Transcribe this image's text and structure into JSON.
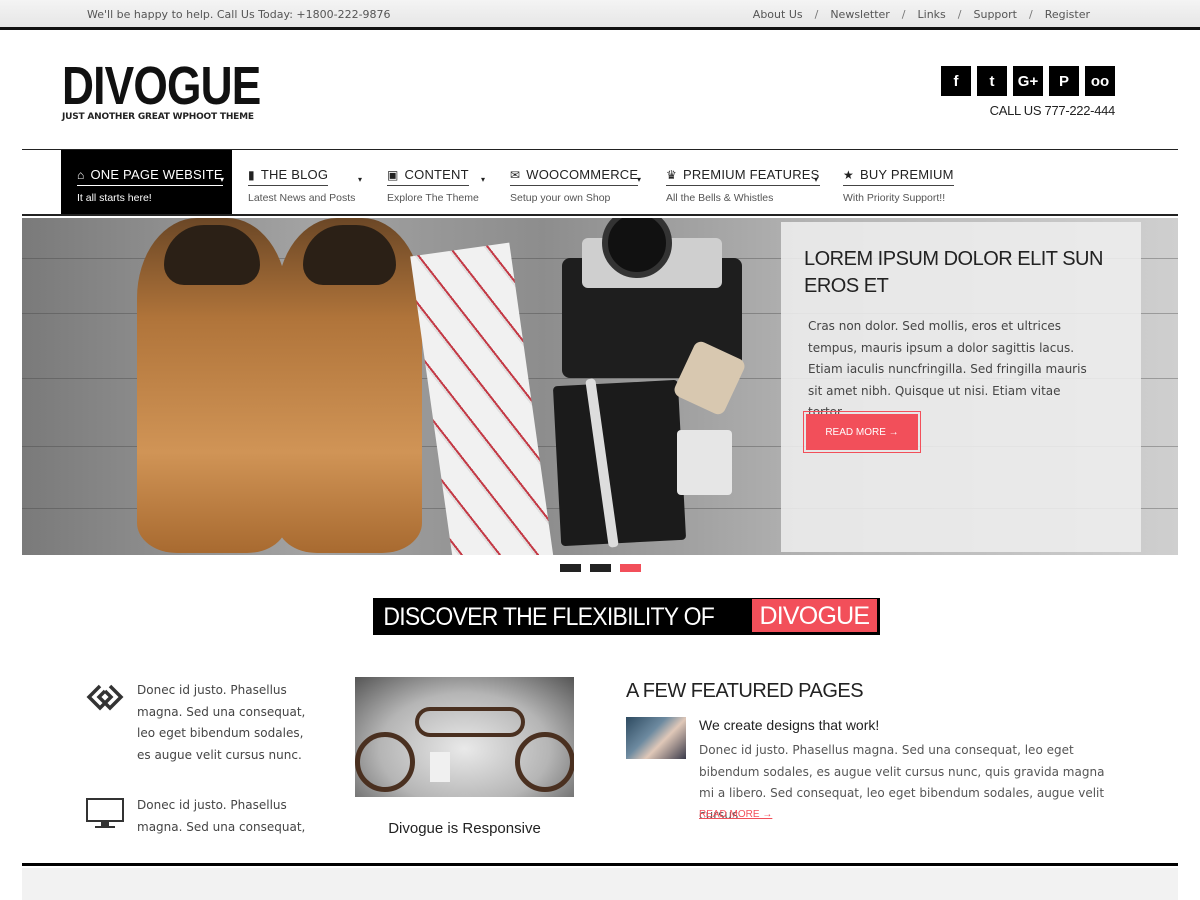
{
  "topbar": {
    "message": "We'll be happy to help. Call Us Today: +1800-222-9876",
    "links": [
      "About Us",
      "Newsletter",
      "Links",
      "Support",
      "Register"
    ],
    "separator": "/"
  },
  "header": {
    "logo_title": "DIVOGUE",
    "logo_tagline": "JUST ANOTHER GREAT WPHOOT THEME",
    "social_icons": [
      "facebook-icon",
      "twitter-icon",
      "google-plus-icon",
      "pinterest-icon",
      "tripadvisor-icon"
    ],
    "social_glyphs": [
      "f",
      "t",
      "G+",
      "P",
      "oo"
    ],
    "call_us": "CALL US 777-222-444"
  },
  "nav": {
    "items": [
      {
        "label": "ONE PAGE WEBSITE",
        "sub": "It all starts here!",
        "icon": "home-icon",
        "glyph": "⌂",
        "active": true
      },
      {
        "label": "THE BLOG",
        "sub": "Latest News and Posts",
        "icon": "book-icon",
        "glyph": "▮"
      },
      {
        "label": "CONTENT",
        "sub": "Explore The Theme",
        "icon": "image-icon",
        "glyph": "▣"
      },
      {
        "label": "WOOCOMMERCE",
        "sub": "Setup your own Shop",
        "icon": "gift-icon",
        "glyph": "✉"
      },
      {
        "label": "PREMIUM FEATURES",
        "sub": "All the Bells & Whistles",
        "icon": "trophy-icon",
        "glyph": "♛"
      },
      {
        "label": "BUY PREMIUM",
        "sub": "With Priority Support!!",
        "icon": "star-icon",
        "glyph": "★"
      }
    ],
    "caret": "▾"
  },
  "slider": {
    "title": "LOREM IPSUM DOLOR ELIT SUN EROS ET",
    "text": "Cras non dolor. Sed mollis, eros et ultrices tempus, mauris ipsum a dolor sagittis lacus. Etiam iaculis nuncfringilla. Sed fringilla mauris sit amet nibh. Quisque ut nisi. Etiam vitae tortor.",
    "button": "READ MORE →",
    "slide_count": 3,
    "active_slide": 3
  },
  "discover": {
    "text": "DISCOVER THE FLEXIBILITY OF",
    "highlight": "DIVOGUE"
  },
  "features": [
    {
      "icon": "link-icon",
      "text": "Donec id justo. Phasellus magna. Sed una consequat, leo eget bibendum sodales, es augue velit cursus nunc."
    },
    {
      "icon": "monitor-icon",
      "text": "Donec id justo. Phasellus magna. Sed una consequat,"
    }
  ],
  "responsive": {
    "caption": "Divogue is Responsive"
  },
  "featured_pages": {
    "heading": "A FEW FEATURED PAGES",
    "title": "We create designs that work!",
    "text": "Donec id justo. Phasellus magna. Sed una consequat, leo eget bibendum sodales, es augue velit cursus nunc, quis gravida magna mi a libero. Sed consequat, leo eget bibendum sodales, augue velit cursus",
    "more": "READ MORE →"
  },
  "colors": {
    "accent": "#f24f5a",
    "dark": "#000000"
  }
}
